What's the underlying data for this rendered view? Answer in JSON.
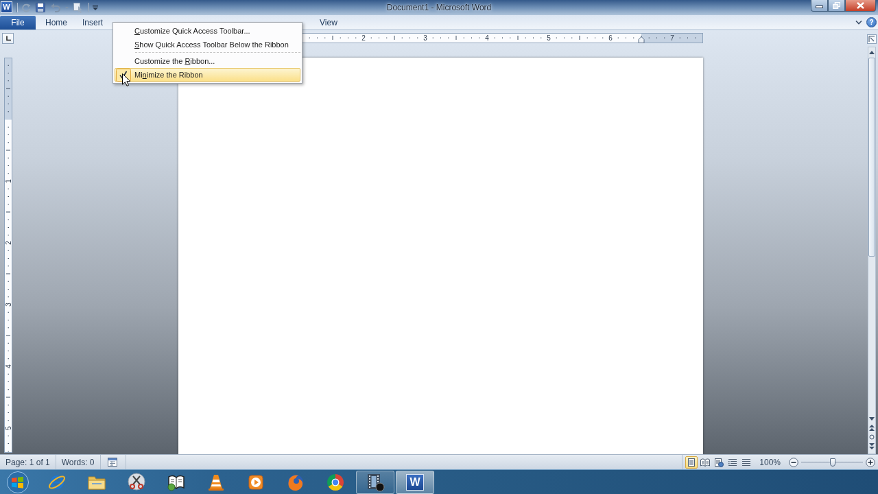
{
  "title_bar": {
    "app_letter": "W",
    "title": "Document1 - Microsoft Word"
  },
  "ribbon_tabs": [
    {
      "label": "File",
      "kind": "backstage",
      "selected": false
    },
    {
      "label": "Home",
      "kind": "tab",
      "selected": false
    },
    {
      "label": "Insert",
      "kind": "tab",
      "selected": false
    },
    {
      "label": "View",
      "kind": "tab",
      "selected": false
    }
  ],
  "help_button": {
    "label": "?"
  },
  "horizontal_ruler": {
    "labels": [
      "2",
      "3",
      "4",
      "5",
      "6",
      "7"
    ]
  },
  "vertical_ruler": {
    "labels": [
      "1",
      "2",
      "3",
      "4",
      "5"
    ]
  },
  "context_menu": {
    "items": [
      {
        "kind": "item",
        "access_key": "C",
        "after": "ustomize Quick Access Toolbar...",
        "checked": false,
        "selected": false
      },
      {
        "kind": "item",
        "access_key": "S",
        "after": "how Quick Access Toolbar Below the Ribbon",
        "checked": false,
        "selected": false
      },
      {
        "kind": "separator"
      },
      {
        "kind": "item",
        "before": "Customize the ",
        "access_key": "R",
        "after": "ibbon...",
        "checked": false,
        "selected": false
      },
      {
        "kind": "item",
        "before": "Mi",
        "access_key": "n",
        "after": "imize the Ribbon",
        "checked": true,
        "selected": true
      }
    ]
  },
  "status_bar": {
    "page": "Page: 1 of 1",
    "words": "Words: 0",
    "views": [
      {
        "kind": "print",
        "selected": true
      },
      {
        "kind": "reading",
        "selected": false
      },
      {
        "kind": "web",
        "selected": false
      },
      {
        "kind": "outline",
        "selected": false
      },
      {
        "kind": "draft",
        "selected": false
      }
    ],
    "zoom": {
      "reading": "100%",
      "level": 0.51
    }
  },
  "taskbar": {
    "items": [
      {
        "kind": "browser",
        "running": false,
        "selected": false
      },
      {
        "kind": "folder",
        "running": false,
        "selected": false
      },
      {
        "kind": "scissors",
        "running": false,
        "selected": false
      },
      {
        "kind": "book",
        "running": false,
        "selected": false
      },
      {
        "kind": "cone",
        "running": false,
        "selected": false
      },
      {
        "kind": "player",
        "running": false,
        "selected": false
      },
      {
        "kind": "swirl",
        "running": false,
        "selected": false
      },
      {
        "kind": "wheel",
        "running": false,
        "selected": false
      },
      {
        "kind": "film",
        "running": true,
        "selected": false
      },
      {
        "kind": "word",
        "letter": "W",
        "running": true,
        "selected": true
      }
    ]
  }
}
